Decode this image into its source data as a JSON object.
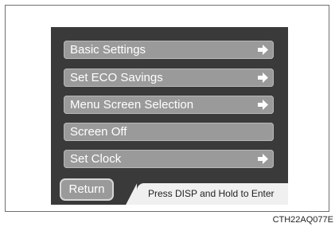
{
  "menu": {
    "items": [
      {
        "label": "Basic Settings",
        "arrow": true
      },
      {
        "label": "Set ECO Savings",
        "arrow": true
      },
      {
        "label": "Menu Screen Selection",
        "arrow": true
      },
      {
        "label": "Screen Off",
        "arrow": false
      },
      {
        "label": "Set Clock",
        "arrow": true
      }
    ]
  },
  "footer": {
    "return_label": "Return",
    "hint": "Press DISP and Hold to Enter"
  },
  "figure_code": "CTH22AQ077E",
  "colors": {
    "screen_bg": "#3a3a3a",
    "button_bg": "#9a9a9a",
    "hint_bg": "#f0f0f0"
  },
  "icons": {
    "arrow": "arrow-right-icon"
  }
}
